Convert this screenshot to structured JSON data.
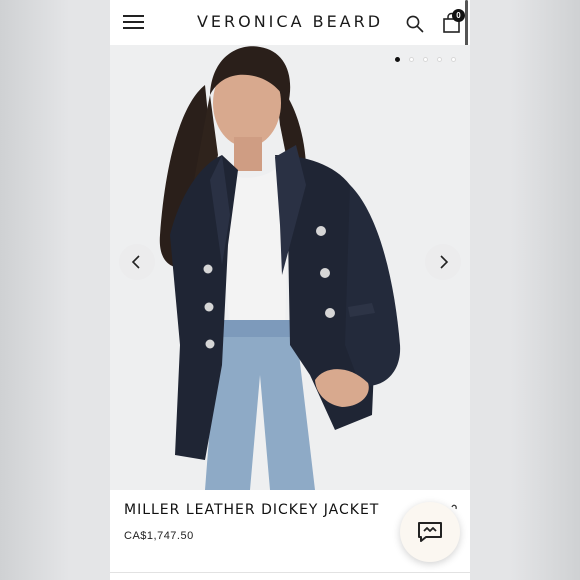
{
  "header": {
    "brand": "VERONICA BEARD",
    "bag_count": "0",
    "menu_icon": "hamburger-menu-icon",
    "search_icon": "search-icon",
    "bag_icon": "shopping-bag-icon"
  },
  "carousel": {
    "slide_count": 5,
    "active_index": 0,
    "prev_icon": "chevron-left-icon",
    "next_icon": "chevron-right-icon"
  },
  "product": {
    "name": "MILLER LEATHER DICKEY JACKET",
    "price": "CA$1,747.50"
  },
  "chat": {
    "icon": "chat-icon"
  },
  "colors": {
    "jacket": "#1f2534",
    "denim": "#8eaac6",
    "hero_bg": "#eeeff0",
    "chat_bg": "#fbf7f1"
  }
}
